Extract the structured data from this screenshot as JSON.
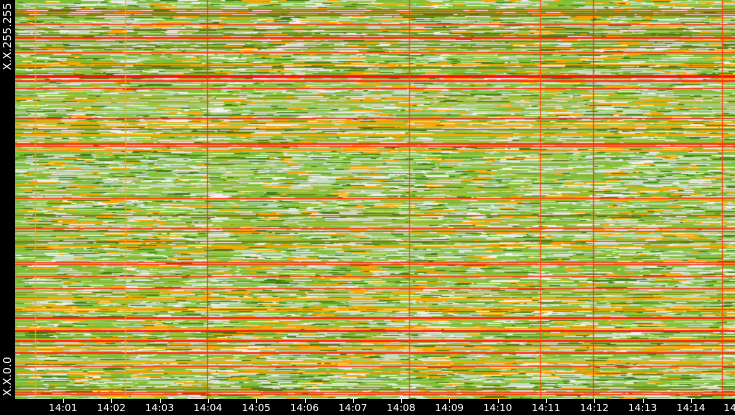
{
  "chart_data": {
    "type": "heatmap",
    "title": "",
    "xlabel": "",
    "ylabel": "",
    "y_tick_labels": [
      "X.X.255.255",
      "X.X.0.0"
    ],
    "x_tick_labels": [
      "14:01",
      "14:02",
      "14:03",
      "14:04",
      "14:05",
      "14:06",
      "14:07",
      "14:08",
      "14:09",
      "14:10",
      "14:11",
      "14:12",
      "14:13",
      "14:14",
      "14"
    ],
    "x_range_minutes": [
      0,
      15
    ],
    "color_scale": [
      "#f4f4f4",
      "#8cc63f",
      "#5a9e1a",
      "#ffa500",
      "#ff2020"
    ]
  }
}
